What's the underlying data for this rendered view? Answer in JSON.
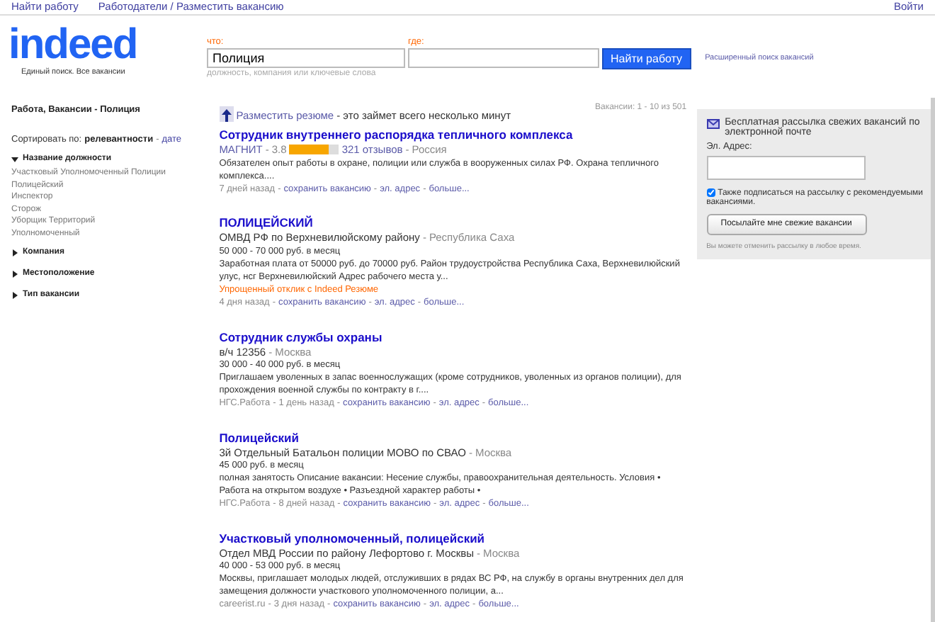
{
  "top_nav": {
    "links": [
      "Найти работу",
      "Работодатели / Разместить вакансию"
    ],
    "login": "Войти"
  },
  "logo": {
    "text": "indeed",
    "tagline": "Единый поиск. Все вакансии"
  },
  "search": {
    "what_label": "что:",
    "what_value": "Полиция",
    "what_hint": "должность, компания или ключевые слова",
    "where_label": "где:",
    "button": "Найти работу",
    "advanced": "Расширенный поиск вакансий"
  },
  "sidebar": {
    "heading": "Работа, Вакансии - Полиция",
    "sort_label": "Сортировать по:",
    "sort_options": [
      {
        "label": "релевантности",
        "selected": true
      },
      {
        "label": "дате",
        "selected": false
      }
    ],
    "filters": [
      {
        "label": "Название должности",
        "expanded": true,
        "items": [
          "Участковый Уполномоченный Полиции",
          "Полицейский",
          "Инспектор",
          "Сторож",
          "Уборщик Территорий",
          "Уполномоченный"
        ]
      },
      {
        "label": "Компания",
        "expanded": false
      },
      {
        "label": "Местоположение",
        "expanded": false
      },
      {
        "label": "Тип вакансии",
        "expanded": false
      }
    ]
  },
  "separator": "-",
  "resume_promo": {
    "link": "Разместить резюме",
    "text": " - это займет всего несколько минут"
  },
  "count": "Вакансии: 1 - 10 из 501",
  "jobs": [
    {
      "title": "Сотрудник внутреннего распорядка тепличного комплекса",
      "company": "МАГНИТ",
      "rating": "3.8",
      "stars": 4,
      "reviews": "321 отзывов",
      "location": "Россия",
      "snippet": "Обязателен опыт работы в охране, полиции или служба в вооруженных силах РФ. Охрана тепличного комплекса....",
      "date": "7 дней назад",
      "links": [
        "сохранить вакансию",
        "эл. адрес",
        "больше..."
      ]
    },
    {
      "title": "ПОЛИЦЕЙСКИЙ",
      "company": "ОМВД РФ по Верхневилюйскому району",
      "location": "Республика Саха",
      "salary": "50 000 - 70 000 руб. в месяц",
      "snippet": "Заработная плата от 50000 руб. до 70000 руб. Район трудоустройства Республика Саха, Верхневилюйский улус, нсг Верхневилюйский Адрес рабочего места у...",
      "easy_apply": "Упрощенный отклик с Indeed Резюме",
      "date": "4 дня назад",
      "links": [
        "сохранить вакансию",
        "эл. адрес",
        "больше..."
      ]
    },
    {
      "title": "Сотрудник службы охраны",
      "company": "в/ч 12356",
      "location": "Москва",
      "salary": "30 000 - 40 000 руб. в месяц",
      "snippet": "Приглашаем уволенных в запас военнослужащих (кроме сотрудников, уволенных из органов полиции), для прохождения военной службы по контракту в г....",
      "source": "НГС.Работа",
      "date": "1 день назад",
      "links": [
        "сохранить вакансию",
        "эл. адрес",
        "больше..."
      ]
    },
    {
      "title": "Полицейский",
      "company": "3й Отдельный Батальон полиции МОВО по СВАО",
      "location": "Москва",
      "salary": "45 000 руб. в месяц",
      "snippet": "полная занятость Описание вакансии: Несение службы, правоохранительная деятельность. Условия • Работа на открытом воздухе • Разъездной характер работы •",
      "source": "НГС.Работа",
      "date": "8 дней назад",
      "links": [
        "сохранить вакансию",
        "эл. адрес",
        "больше..."
      ]
    },
    {
      "title": "Участковый уполномоченный, полицейский",
      "company": "Отдел МВД России по району Лефортово г. Москвы",
      "location": "Москва",
      "salary": "40 000 - 53 000 руб. в месяц",
      "snippet": "Москвы, приглашает молодых людей, отслуживших в рядах ВС РФ, на службу в органы внутренних дел для замещения должности участкового уполномоченного полиции, а...",
      "source": "careerist.ru",
      "date": "3 дня назад",
      "links": [
        "сохранить вакансию",
        "эл. адрес",
        "больше..."
      ]
    }
  ],
  "alert": {
    "title": "Бесплатная рассылка свежих вакансий по электронной почте",
    "email_label": "Эл. Адрес:",
    "also_subscribe": {
      "label": "Также подписаться на рассылку с рекомендуемыми вакансиями.",
      "checked": true
    },
    "button": "Посылайте мне свежие вакансии",
    "note": "Вы можете отменить рассылку в любое время."
  }
}
